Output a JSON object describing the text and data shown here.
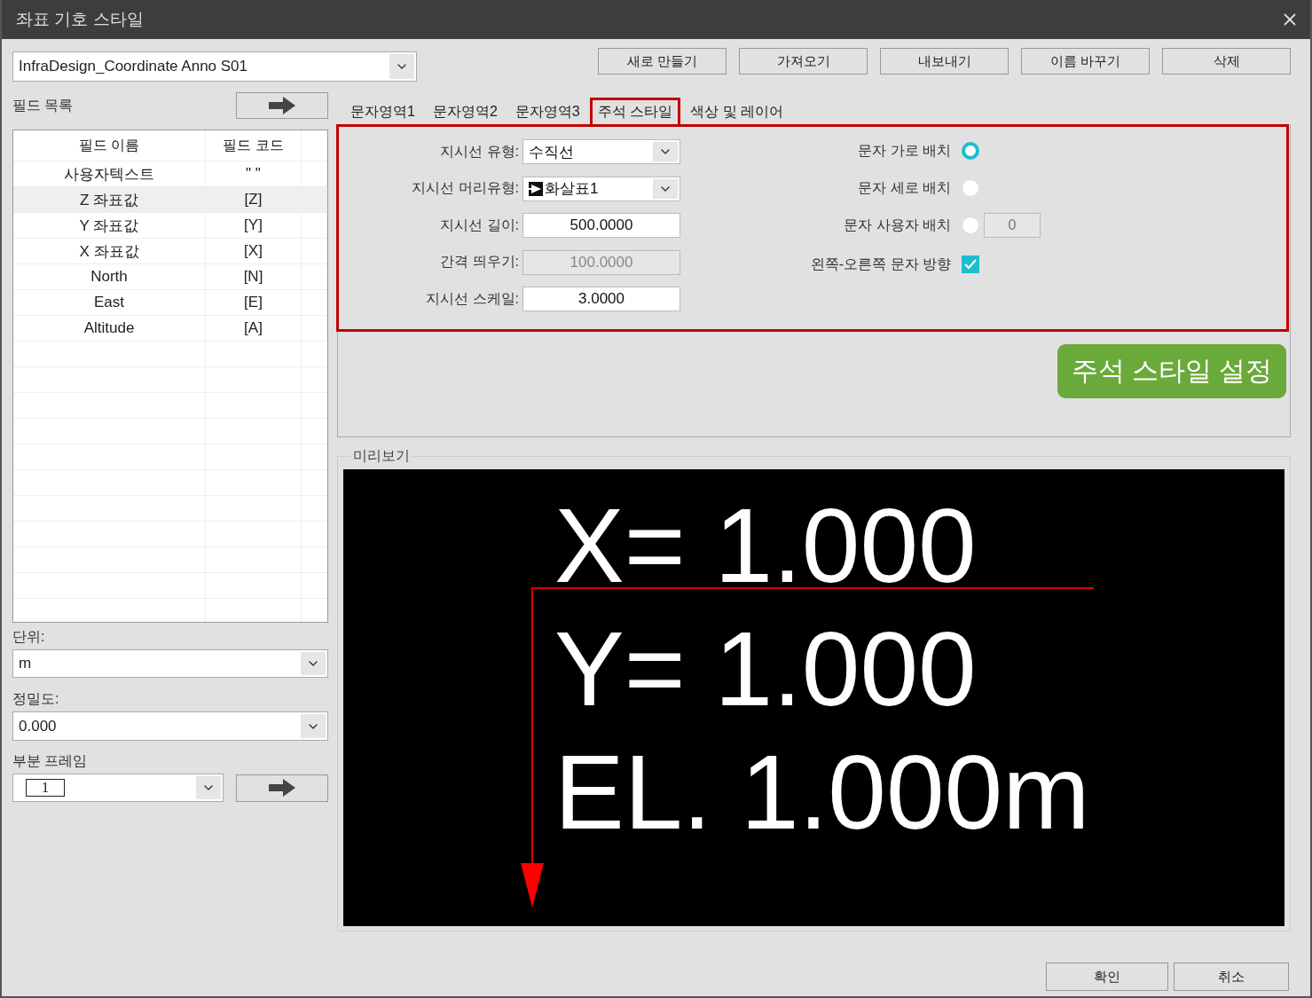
{
  "window": {
    "title": "좌표 기호 스타일"
  },
  "style_select": {
    "value": "InfraDesign_Coordinate Anno S01"
  },
  "toolbar_buttons": [
    "새로 만들기",
    "가져오기",
    "내보내기",
    "이름 바꾸기",
    "삭제"
  ],
  "field_list": {
    "label": "필드 목록",
    "columns": [
      "필드 이름",
      "필드 코드"
    ],
    "rows": [
      {
        "name": "사용자텍스트",
        "code": "\" \"",
        "selected": false
      },
      {
        "name": "Z 좌표값",
        "code": "[Z]",
        "selected": true
      },
      {
        "name": "Y 좌표값",
        "code": "[Y]",
        "selected": false
      },
      {
        "name": "X 좌표값",
        "code": "[X]",
        "selected": false
      },
      {
        "name": "North",
        "code": "[N]",
        "selected": false
      },
      {
        "name": "East",
        "code": "[E]",
        "selected": false
      },
      {
        "name": "Altitude",
        "code": "[A]",
        "selected": false
      }
    ]
  },
  "units": {
    "label": "단위:",
    "value": "m"
  },
  "precision": {
    "label": "정밀도:",
    "value": "0.000"
  },
  "frame": {
    "label": "부분 프레임",
    "value": "1"
  },
  "tabs": [
    {
      "label": "문자영역1",
      "selected": false
    },
    {
      "label": "문자영역2",
      "selected": false
    },
    {
      "label": "문자영역3",
      "selected": false
    },
    {
      "label": "주석 스타일",
      "selected": true
    },
    {
      "label": "색상 및 레이어",
      "selected": false
    }
  ],
  "leader_fields": [
    {
      "kind": "select",
      "label": "지시선 유형:",
      "value": "수직선"
    },
    {
      "kind": "arrowhead-select",
      "label": "지시선 머리유형:",
      "value": "화살표1"
    },
    {
      "kind": "input",
      "label": "지시선 길이:",
      "value": "500.0000",
      "disabled": false
    },
    {
      "kind": "input",
      "label": "간격 띄우기:",
      "value": "100.0000",
      "disabled": true
    },
    {
      "kind": "input",
      "label": "지시선 스케일:",
      "value": "3.0000",
      "disabled": false
    }
  ],
  "text_options": [
    {
      "kind": "radio",
      "label": "문자 가로 배치",
      "selected": true
    },
    {
      "kind": "radio",
      "label": "문자 세로 배치",
      "selected": false
    },
    {
      "kind": "radio",
      "label": "문자 사용자 배치",
      "selected": false,
      "value": "0"
    },
    {
      "kind": "checkbox",
      "label": "왼쪽-오른쪽 문자 방향",
      "checked": true
    }
  ],
  "callout": "주석 스타일 설정",
  "preview": {
    "label": "미리보기",
    "lines": [
      "X= 1.000",
      "Y= 1.000",
      "EL. 1.000m"
    ]
  },
  "dialog_buttons": [
    "확인",
    "취소"
  ]
}
